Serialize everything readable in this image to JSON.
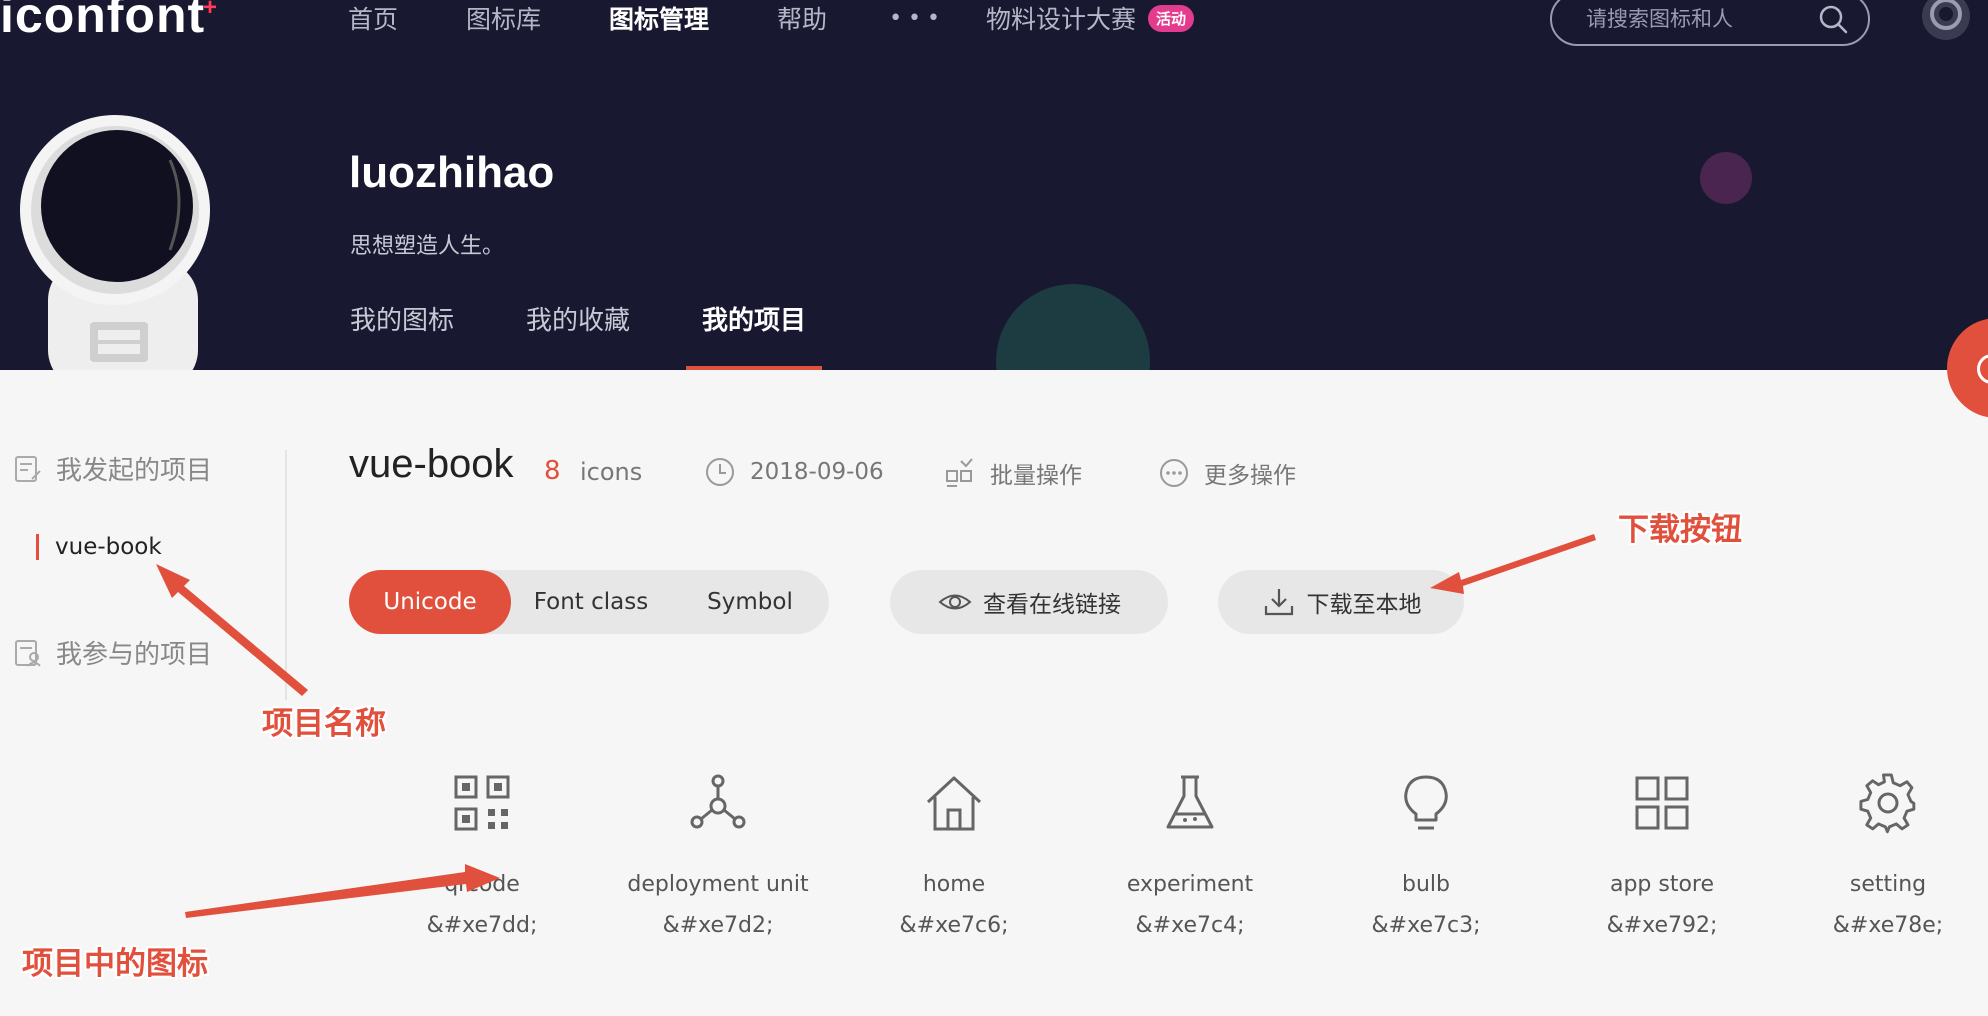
{
  "header": {
    "logo": "iconfont",
    "nav": [
      {
        "label": "首页",
        "active": false
      },
      {
        "label": "图标库",
        "active": false
      },
      {
        "label": "图标管理",
        "active": true
      },
      {
        "label": "帮助",
        "active": false
      }
    ],
    "more_dots": "•••",
    "contest_label": "物料设计大赛",
    "contest_badge": "活动",
    "search_placeholder": "请搜索图标和人"
  },
  "profile": {
    "username": "luozhihao",
    "motto": "思想塑造人生。",
    "tabs": [
      {
        "label": "我的图标",
        "active": false
      },
      {
        "label": "我的收藏",
        "active": false
      },
      {
        "label": "我的项目",
        "active": true
      }
    ]
  },
  "sidebar": {
    "created_heading": "我发起的项目",
    "projects": [
      "vue-book"
    ],
    "joined_heading": "我参与的项目"
  },
  "project": {
    "name": "vue-book",
    "icon_count": "8",
    "icon_count_label": "icons",
    "date": "2018-09-06",
    "batch_label": "批量操作",
    "more_label": "更多操作",
    "modes": [
      {
        "label": "Unicode",
        "active": true
      },
      {
        "label": "Font class",
        "active": false
      },
      {
        "label": "Symbol",
        "active": false
      }
    ],
    "view_link_label": "查看在线链接",
    "download_label": "下载至本地"
  },
  "icons": [
    {
      "name": "qrcode",
      "code": "&#xe7dd;",
      "icon": "qrcode-icon"
    },
    {
      "name": "deployment unit",
      "code": "&#xe7d2;",
      "icon": "deployment-unit-icon"
    },
    {
      "name": "home",
      "code": "&#xe7c6;",
      "icon": "home-icon"
    },
    {
      "name": "experiment",
      "code": "&#xe7c4;",
      "icon": "experiment-icon"
    },
    {
      "name": "bulb",
      "code": "&#xe7c3;",
      "icon": "bulb-icon"
    },
    {
      "name": "app store",
      "code": "&#xe792;",
      "icon": "app-store-icon"
    },
    {
      "name": "setting",
      "code": "&#xe78e;",
      "icon": "setting-icon"
    }
  ],
  "annotations": {
    "download_button": "下载按钮",
    "project_name": "项目名称",
    "project_icons": "项目中的图标"
  },
  "colors": {
    "header_bg": "#181830",
    "accent": "#e1503d",
    "badge": "#e33b8e",
    "page_bg": "#f6f6f6"
  }
}
